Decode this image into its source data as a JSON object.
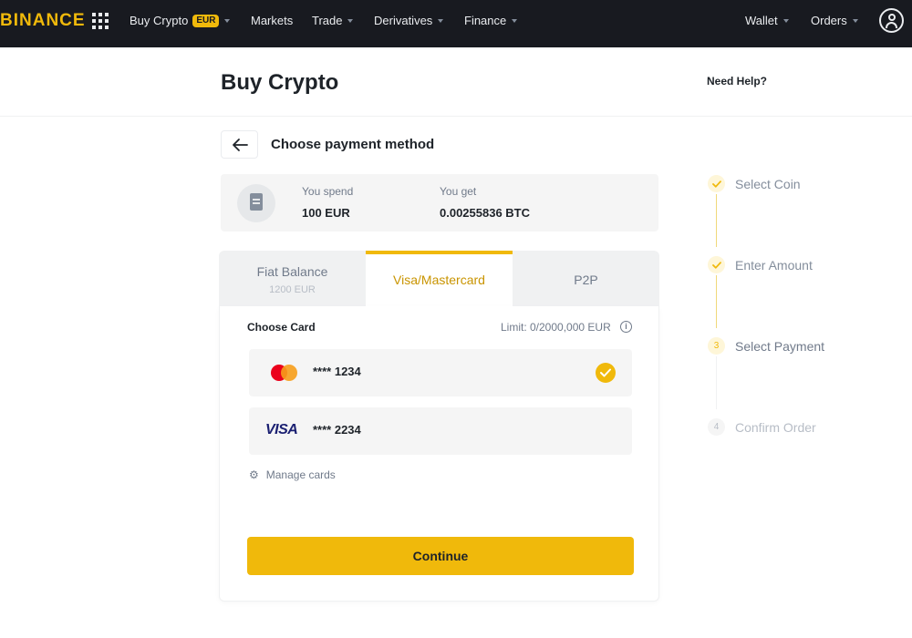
{
  "nav": {
    "logo": "BINANCE",
    "items": [
      {
        "label": "Buy Crypto",
        "badge": "EUR"
      },
      {
        "label": "Markets"
      },
      {
        "label": "Trade"
      },
      {
        "label": "Derivatives"
      },
      {
        "label": "Finance"
      }
    ],
    "right": [
      {
        "label": "Wallet"
      },
      {
        "label": "Orders"
      }
    ],
    "icons": {
      "apps": "grid-icon",
      "account": "user-icon"
    }
  },
  "header": {
    "title": "Buy Crypto",
    "help": "Need Help?"
  },
  "payment": {
    "title": "Choose payment method",
    "summary": {
      "spend_label": "You spend",
      "spend_value": "100 EUR",
      "get_label": "You get",
      "get_value": "0.00255836 BTC"
    },
    "tabs": [
      {
        "label": "Fiat Balance",
        "sub": "1200 EUR"
      },
      {
        "label": "Visa/Mastercard",
        "active": true
      },
      {
        "label": "P2P"
      }
    ],
    "choose_card": "Choose Card",
    "limit": "Limit: 0/2000,000 EUR",
    "cards": [
      {
        "brand": "mastercard",
        "number": "**** 1234",
        "selected": true
      },
      {
        "brand": "visa",
        "brand_label": "VISA",
        "number": "**** 2234",
        "selected": false
      }
    ],
    "manage": "Manage cards",
    "continue": "Continue"
  },
  "steps": [
    {
      "label": "Select Coin",
      "state": "done"
    },
    {
      "label": "Enter Amount",
      "state": "done"
    },
    {
      "number": "3",
      "label": "Select Payment",
      "state": "current"
    },
    {
      "number": "4",
      "label": "Confirm Order",
      "state": "todo"
    }
  ],
  "colors": {
    "brand": "#f0b90b",
    "nav_bg": "#181a20",
    "text": "#1e2329",
    "muted": "#707a8a"
  }
}
